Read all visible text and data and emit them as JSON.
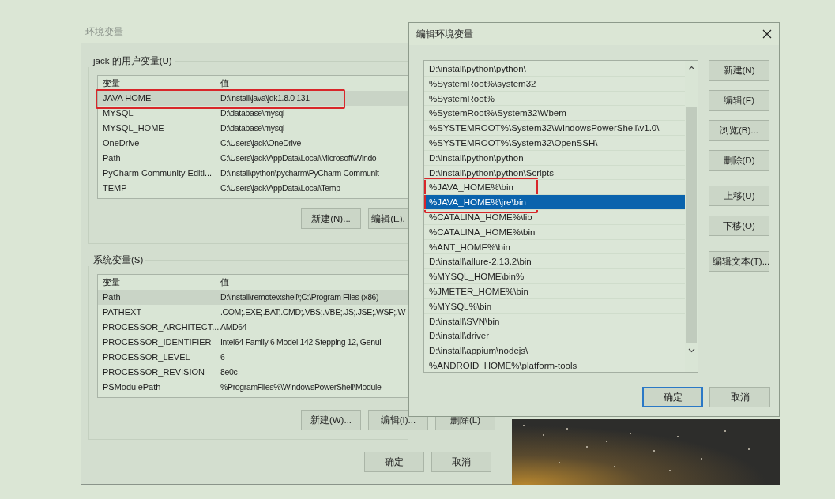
{
  "env_window": {
    "title": "环境变量",
    "user_group": {
      "label": "jack 的用户变量(U)",
      "columns": [
        "变量",
        "值"
      ],
      "rows": [
        {
          "name": "JAVA HOME",
          "value": "D:\\install\\java\\jdk1.8.0 131",
          "selected": true,
          "highlighted": true
        },
        {
          "name": "MYSQL",
          "value": "D:\\database\\mysql",
          "selected": false,
          "highlighted": false
        },
        {
          "name": "MYSQL_HOME",
          "value": "D:\\database\\mysql",
          "selected": false,
          "highlighted": false
        },
        {
          "name": "OneDrive",
          "value": "C:\\Users\\jack\\OneDrive",
          "selected": false,
          "highlighted": false
        },
        {
          "name": "Path",
          "value": "C:\\Users\\jack\\AppData\\Local\\Microsoft\\Windo",
          "selected": false,
          "highlighted": false
        },
        {
          "name": "PyCharm Community Editi...",
          "value": "D:\\install\\python\\pycharm\\PyCharm Communit",
          "selected": false,
          "highlighted": false
        },
        {
          "name": "TEMP",
          "value": "C:\\Users\\jack\\AppData\\Local\\Temp",
          "selected": false,
          "highlighted": false
        }
      ],
      "buttons": [
        "新建(N)...",
        "编辑(E)."
      ]
    },
    "system_group": {
      "label": "系统变量(S)",
      "columns": [
        "变量",
        "值"
      ],
      "rows": [
        {
          "name": "Path",
          "value": "D:\\install\\remote\\xshell\\;C:\\Program Files (x86)",
          "selected": true,
          "highlighted": false
        },
        {
          "name": "PATHEXT",
          "value": ".COM;.EXE;.BAT;.CMD;.VBS;.VBE;.JS;.JSE;.WSF;.W",
          "selected": false,
          "highlighted": false
        },
        {
          "name": "PROCESSOR_ARCHITECT...",
          "value": "AMD64",
          "selected": false,
          "highlighted": false
        },
        {
          "name": "PROCESSOR_IDENTIFIER",
          "value": "Intel64 Family 6 Model 142 Stepping 12, Genui",
          "selected": false,
          "highlighted": false
        },
        {
          "name": "PROCESSOR_LEVEL",
          "value": "6",
          "selected": false,
          "highlighted": false
        },
        {
          "name": "PROCESSOR_REVISION",
          "value": "8e0c",
          "selected": false,
          "highlighted": false
        },
        {
          "name": "PSModulePath",
          "value": "%ProgramFiles%\\WindowsPowerShell\\Module",
          "selected": false,
          "highlighted": false
        }
      ],
      "buttons": [
        "新建(W)...",
        "编辑(I)...",
        "删除(L)"
      ]
    },
    "buttons": [
      "确定",
      "取消"
    ]
  },
  "edit_dialog": {
    "title": "编辑环境变量",
    "entries": [
      {
        "text": "D:\\install\\python\\python\\",
        "selected": false,
        "highlighted": false
      },
      {
        "text": "%SystemRoot%\\system32",
        "selected": false,
        "highlighted": false
      },
      {
        "text": "%SystemRoot%",
        "selected": false,
        "highlighted": false
      },
      {
        "text": "%SystemRoot%\\System32\\Wbem",
        "selected": false,
        "highlighted": false
      },
      {
        "text": "%SYSTEMROOT%\\System32\\WindowsPowerShell\\v1.0\\",
        "selected": false,
        "highlighted": false
      },
      {
        "text": "%SYSTEMROOT%\\System32\\OpenSSH\\",
        "selected": false,
        "highlighted": false
      },
      {
        "text": "D:\\install\\python\\python",
        "selected": false,
        "highlighted": false
      },
      {
        "text": "D:\\install\\python\\python\\Scripts",
        "selected": false,
        "highlighted": false
      },
      {
        "text": "%JAVA_HOME%\\bin",
        "selected": false,
        "highlighted": true
      },
      {
        "text": "%JAVA_HOME%\\jre\\bin",
        "selected": true,
        "highlighted": true
      },
      {
        "text": "%CATALINA_HOME%\\lib",
        "selected": false,
        "highlighted": false
      },
      {
        "text": "%CATALINA_HOME%\\bin",
        "selected": false,
        "highlighted": false
      },
      {
        "text": "%ANT_HOME%\\bin",
        "selected": false,
        "highlighted": false
      },
      {
        "text": "D:\\install\\allure-2.13.2\\bin",
        "selected": false,
        "highlighted": false
      },
      {
        "text": "%MYSQL_HOME\\bin%",
        "selected": false,
        "highlighted": false
      },
      {
        "text": "%JMETER_HOME%\\bin",
        "selected": false,
        "highlighted": false
      },
      {
        "text": "%MYSQL%\\bin",
        "selected": false,
        "highlighted": false
      },
      {
        "text": "D:\\install\\SVN\\bin",
        "selected": false,
        "highlighted": false
      },
      {
        "text": "D:\\install\\driver",
        "selected": false,
        "highlighted": false
      },
      {
        "text": "D:\\install\\appium\\nodejs\\",
        "selected": false,
        "highlighted": false
      },
      {
        "text": "%ANDROID_HOME%\\platform-tools",
        "selected": false,
        "highlighted": false
      }
    ],
    "side_buttons": [
      [
        "新建(N)",
        "编辑(E)",
        "浏览(B)...",
        "删除(D)"
      ],
      [
        "上移(U)",
        "下移(O)"
      ],
      [
        "编辑文本(T)..."
      ]
    ],
    "buttons": [
      {
        "label": "确定",
        "default": true
      },
      {
        "label": "取消",
        "default": false
      }
    ]
  }
}
